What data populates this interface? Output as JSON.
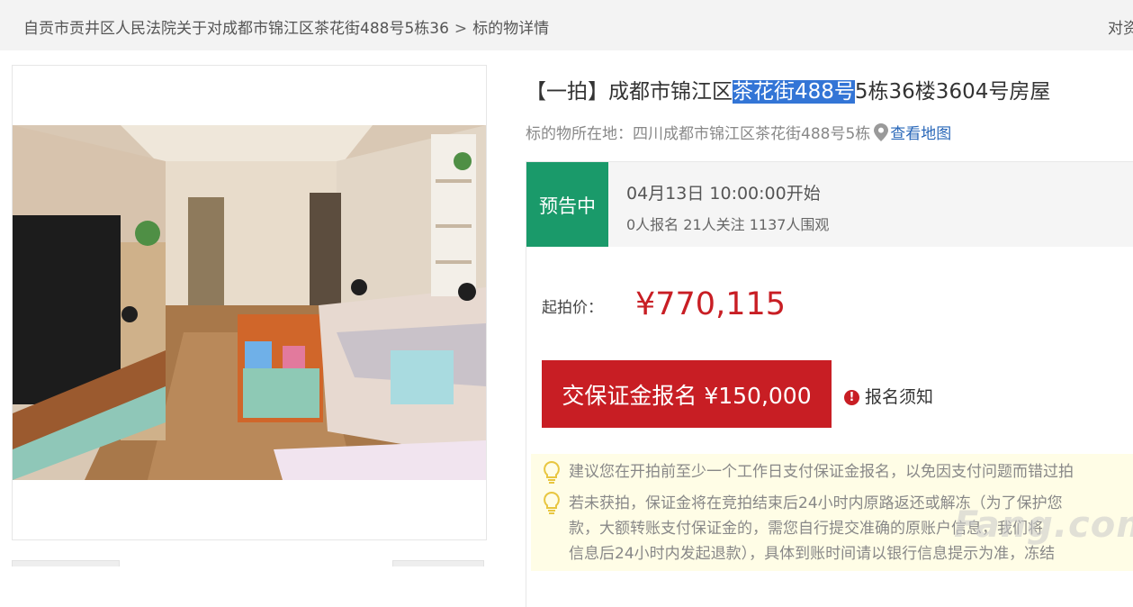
{
  "breadcrumb": {
    "court": "自贡市贡井区人民法院关于对成都市锦江区茶花街488号5栋36",
    "separator": ">",
    "current": "标的物详情",
    "right_text": "对资"
  },
  "item": {
    "title_prefix": "【一拍】成都市锦江区",
    "title_highlight": "茶花街488号",
    "title_suffix": "5栋36楼3604号房屋",
    "location_label": "标的物所在地：",
    "location_value": "四川成都市锦江区茶花街488号5栋",
    "map_link": "查看地图"
  },
  "status": {
    "badge": "预告中",
    "time": "04月13日 10:00:00开始",
    "stats": "0人报名  21人关注  1137人围观",
    "badge_color": "#1a9a6a"
  },
  "price": {
    "start_label": "起拍价：",
    "start_value": "¥770,115",
    "color": "#c81e24"
  },
  "actions": {
    "deposit_button": "交保证金报名 ¥150,000",
    "notice_link": "报名须知"
  },
  "tips": [
    "建议您在开拍前至少一个工作日支付保证金报名，以免因支付问题而错过拍",
    "若未获拍，保证金将在竞拍结束后24小时内原路返还或解冻（为了保护您",
    "款，大额转账支付保证金的，需您自行提交准确的原账户信息，我们将",
    "信息后24小时内发起退款），具体到账时间请以银行信息提示为准，冻结"
  ],
  "watermark": "Fang.com"
}
